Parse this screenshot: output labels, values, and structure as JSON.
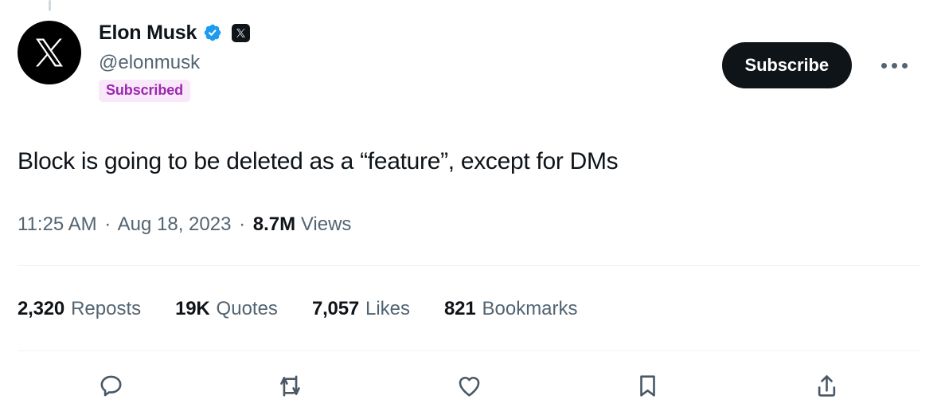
{
  "post": {
    "thread_connector": true,
    "author": {
      "avatar_icon": "x-logo-avatar",
      "display_name": "Elon Musk",
      "verified_icon": "blue-verified-badge-icon",
      "affiliate_icon": "x-affiliate-badge-icon",
      "handle": "@elonmusk",
      "subscribed_label": "Subscribed"
    },
    "actions": {
      "subscribe_label": "Subscribe",
      "more_icon": "more-horizontal-icon"
    },
    "text": "Block is going to be deleted as a “feature”, except for DMs",
    "meta": {
      "time": "11:25 AM",
      "separator": "·",
      "date": "Aug 18, 2023",
      "views_count": "8.7M",
      "views_label": "Views"
    },
    "stats": [
      {
        "value": "2,320",
        "label": "Reposts",
        "name": "reposts"
      },
      {
        "value": "19K",
        "label": "Quotes",
        "name": "quotes"
      },
      {
        "value": "7,057",
        "label": "Likes",
        "name": "likes"
      },
      {
        "value": "821",
        "label": "Bookmarks",
        "name": "bookmarks"
      }
    ],
    "action_bar": [
      {
        "icon": "reply-icon",
        "name": "reply"
      },
      {
        "icon": "repost-icon",
        "name": "repost"
      },
      {
        "icon": "like-icon",
        "name": "like"
      },
      {
        "icon": "bookmark-icon",
        "name": "bookmark"
      },
      {
        "icon": "share-icon",
        "name": "share"
      }
    ]
  },
  "colors": {
    "text_primary": "#0f1419",
    "text_secondary": "#536471",
    "subscribe_bg": "#0f1419",
    "verified_blue": "#1d9bf0",
    "subscribed_text": "#9b28b0",
    "subscribed_bg": "#f9e7fa",
    "divider": "#eff3f4",
    "icon": "#4a5866",
    "thread_line": "#cfd9de"
  }
}
